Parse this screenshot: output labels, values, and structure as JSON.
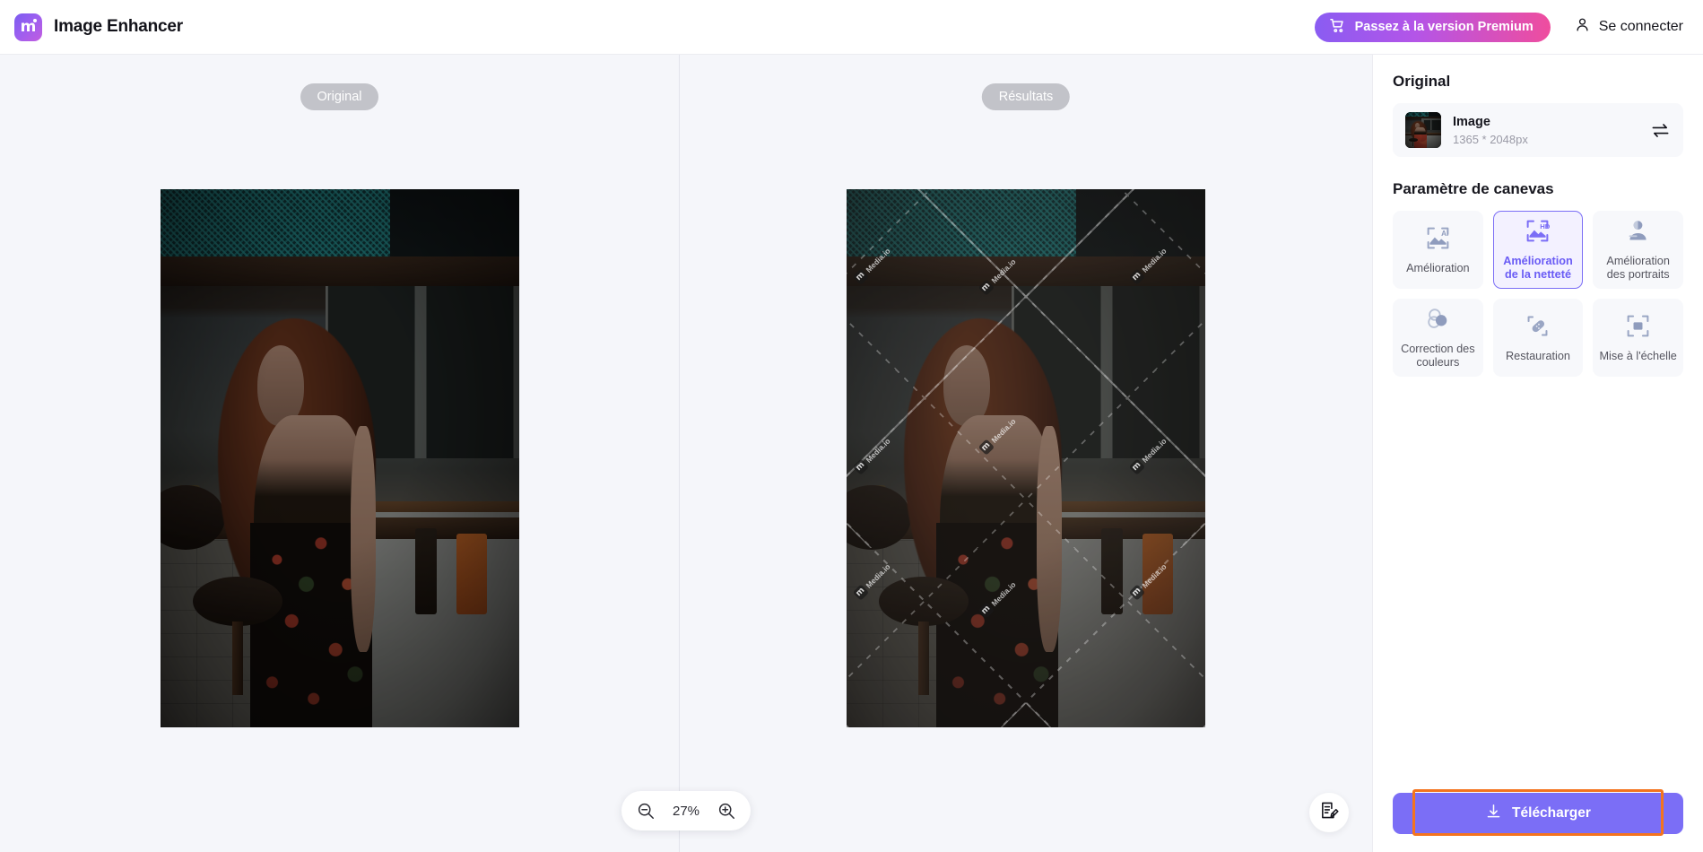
{
  "header": {
    "logo_letter": "m",
    "brand_title": "Image Enhancer",
    "premium_label": "Passez à la version Premium",
    "signin_label": "Se connecter",
    "cart_icon": "cart-icon",
    "user_icon": "user-icon"
  },
  "canvas": {
    "left_pane_label": "Original",
    "right_pane_label": "Résultats",
    "zoom_level": "27%",
    "zoom_out_icon": "zoom-out-icon",
    "zoom_in_icon": "zoom-in-icon",
    "feedback_icon": "feedback-icon",
    "watermark_text": "Media.io",
    "watermark_letter": "m"
  },
  "panel": {
    "original_heading": "Original",
    "file_name": "Image",
    "file_dimensions": "1365 * 2048px",
    "swap_icon": "swap-icon",
    "settings_heading": "Paramètre de canevas",
    "tiles": [
      {
        "label": "Amélioration",
        "icon": "ai-image-icon",
        "selected": false
      },
      {
        "label": "Amélioration de la netteté",
        "icon": "hd-image-icon",
        "selected": true
      },
      {
        "label": "Amélioration des portraits",
        "icon": "portrait-icon",
        "selected": false
      },
      {
        "label": "Correction des couleurs",
        "icon": "color-circles-icon",
        "selected": false
      },
      {
        "label": "Restauration",
        "icon": "bandage-icon",
        "selected": false
      },
      {
        "label": "Mise à l'échelle",
        "icon": "upscale-icon",
        "selected": false
      }
    ],
    "download_label": "Télécharger",
    "download_icon": "download-icon"
  },
  "colors": {
    "accent_purple": "#7b6ef6",
    "premium_gradient_start": "#8a5cf2",
    "premium_gradient_end": "#ef4d9e",
    "annotation_orange": "#f4741e",
    "canvas_bg": "#f5f6fa",
    "pill_gray": "#c2c3c9"
  }
}
